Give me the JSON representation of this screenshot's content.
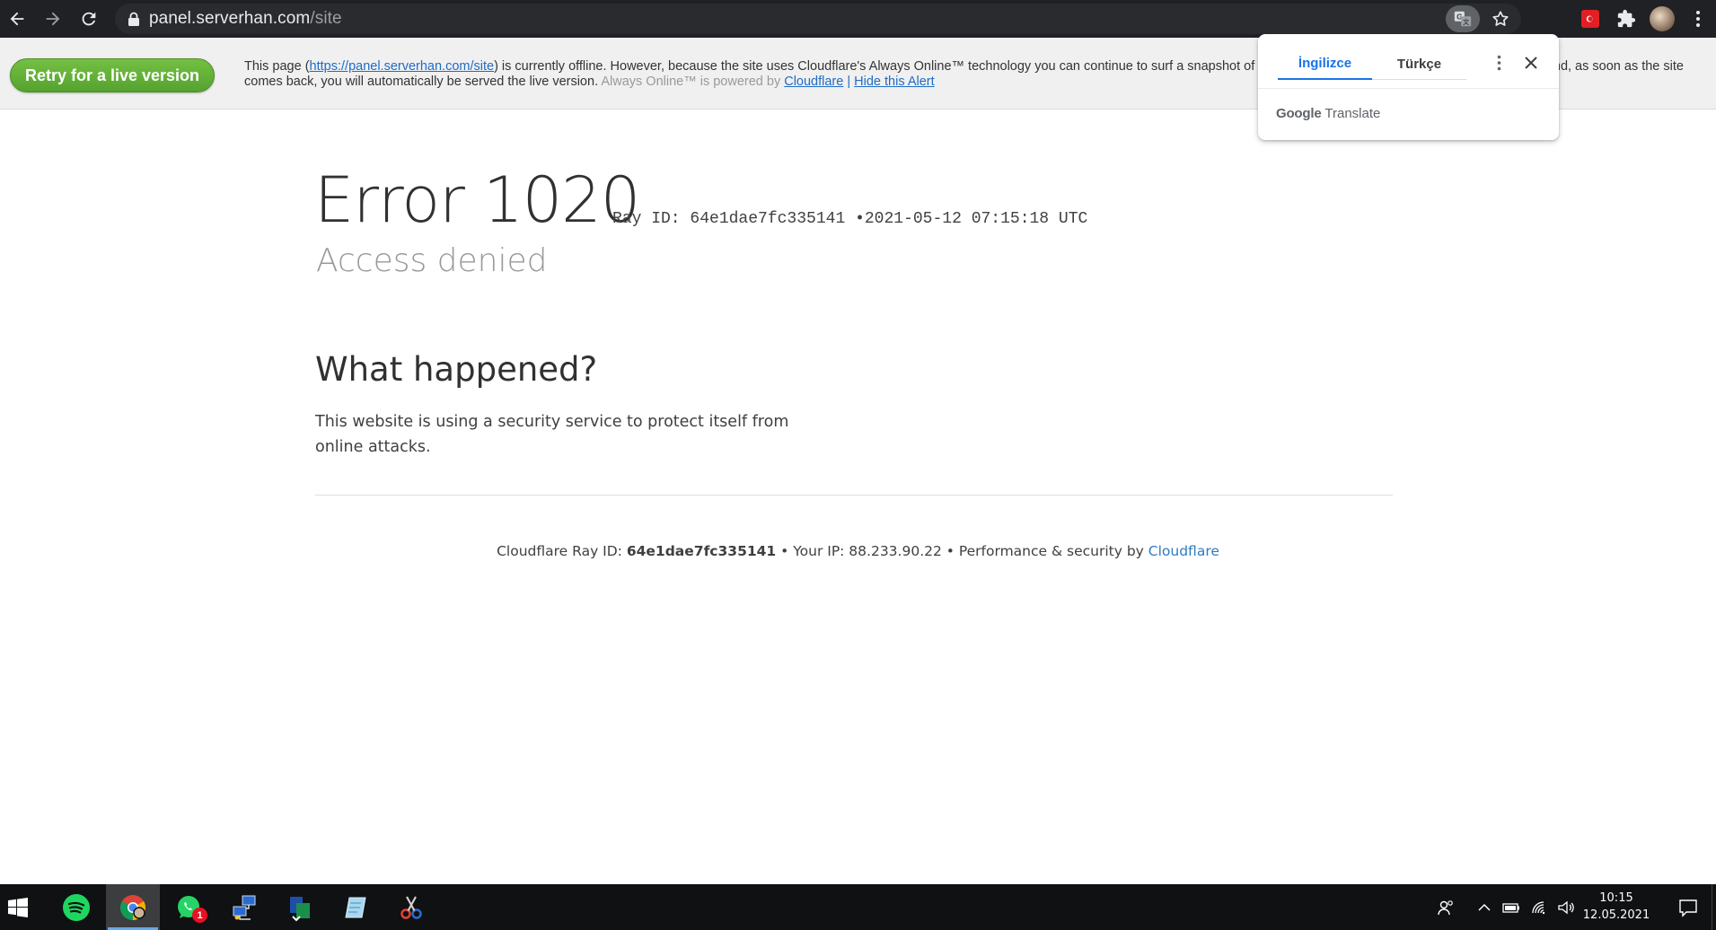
{
  "browser": {
    "url_host": "panel.serverhan.com",
    "url_path": "/site"
  },
  "always_online": {
    "retry_label": "Retry for a live version",
    "text_part1": "This page (",
    "page_link": "https://panel.serverhan.com/site",
    "text_part2": ") is currently offline. However, because the site uses Cloudflare's Always Online™ technology you can continue to surf a snapshot of the site. We will keep checking in the background and, as soon as the site comes back, you will automatically be served the live version.",
    "powered_text": "Always Online™ is powered by",
    "cloudflare_link": "Cloudflare",
    "separator": "|",
    "hide_alert": "Hide this Alert"
  },
  "translate_popup": {
    "tab_source": "İngilizce",
    "tab_target": "Türkçe",
    "brand_google": "Google",
    "brand_translate": "Translate"
  },
  "error": {
    "title": "Error 1020",
    "ray_label": "Ray ID: 64e1dae7fc335141",
    "bullet": "•",
    "timestamp": "2021-05-12 07:15:18 UTC",
    "subtitle": "Access denied",
    "what_heading": "What happened?",
    "explanation": "This website is using a security service to protect itself from online attacks."
  },
  "footer": {
    "ray_prefix": "Cloudflare Ray ID:",
    "ray_id": "64e1dae7fc335141",
    "ip_text": "• Your IP: 88.233.90.22 • Performance & security by",
    "cf_link": "Cloudflare"
  },
  "taskbar": {
    "apps": [
      "spotify-icon",
      "chrome-icon",
      "whatsapp-icon",
      "network-tool-icon",
      "file-transfer-icon",
      "notes-icon",
      "snipping-tool-icon"
    ],
    "whatsapp_badge": "1",
    "time": "10:15",
    "date": "12.05.2021"
  },
  "colors": {
    "retry_green": "#5aa833",
    "link_blue": "#1f6cc4",
    "translate_active": "#1a73e8",
    "taskbar_bg": "#0f1112"
  }
}
